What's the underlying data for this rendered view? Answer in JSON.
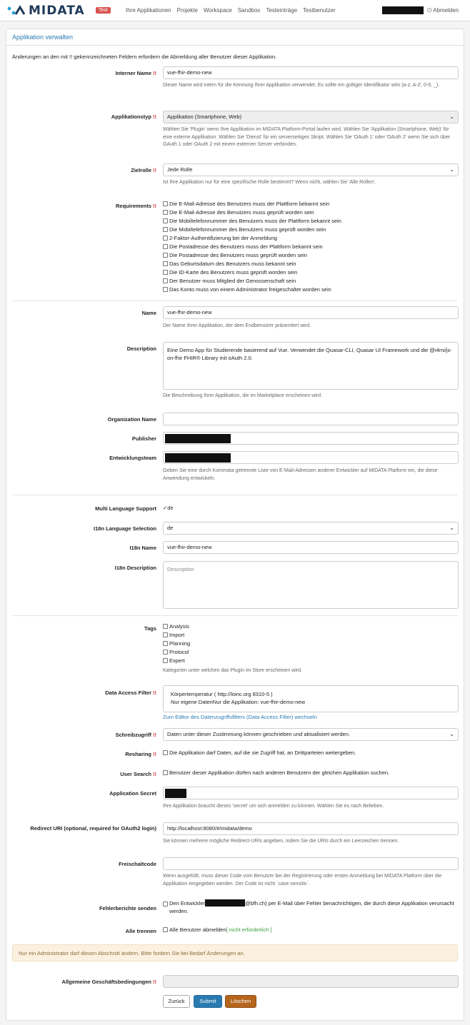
{
  "brand": {
    "logo_text": "MIDATA",
    "badge": "Test",
    "accent": "#2a7ab0"
  },
  "nav": {
    "links": [
      "Ihre Applikationen",
      "Projekte",
      "Workspace",
      "Sandbox",
      "Testeinträge",
      "Testbenutzer"
    ],
    "logout": "Abmelden"
  },
  "panel": {
    "title": "Applikation verwalten",
    "note": "Änderungen an den mit !! gekennzeichneten Feldern erfordern die Abmeldung aller Benutzer dieser Applikation."
  },
  "req_mark": "!!",
  "internal_name": {
    "label": "Interner Name",
    "value": "vue-fhir-demo-new",
    "help": "Dieser Name wird intern für die Kennung Ihrer Applikation verwendet. Es sollte ein gültiger Identifikator sein (a-z, A-Z, 0-9, _)."
  },
  "app_type": {
    "label": "Applikationstyp",
    "value": "Applikation (Smartphone, Web)",
    "help": "Wählen Sie 'Plugin' wenn Ihre Applikation im MIDATA Platform-Portal laufen wird. Wählen Sie 'Applikation (Smartphone, Web)' für eine externe Applikation. Wählen Sie 'Dienst' für ein serverseitiges Skript. Wählen Sie 'OAuth 1' oder 'OAuth 2' wenn Sie sich über OAuth 1 oder OAuth 2 mit einem externen Server verbinden."
  },
  "target_role": {
    "label": "Zielrolle",
    "value": "Jede Rolle",
    "help": "Ist Ihre Applikation nur für eine spezifische Rolle bestimmt? Wenn nicht, wählen Sie 'Alle Rollen'."
  },
  "requirements": {
    "label": "Requirements",
    "items": [
      "Die E-Mail-Adresse des Benutzers muss der Plattform bekannt sein",
      "Die E-Mail-Adresse des Benutzers muss geprüft worden sein",
      "Die Mobiltelefonnummer des Benutzers muss der Plattform bekannt sein",
      "Die Mobiltelefonnummer des Benutzers muss geprüft worden sein",
      "2-Faktor-Authentifizierung bei der Anmeldung",
      "Die Postadresse des Benutzers muss der Plattform bekannt sein",
      "Die Postadresse des Benutzers muss geprüft worden sein",
      "Das Geburtsdatum des Benutzers muss bekannt sein",
      "Die ID-Karte des Benutzers muss geprüft worden sein",
      "Der Benutzer muss Mitglied der Genossenschaft sein",
      "Das Konto muss von einem Administrator freigeschaltet worden sein"
    ]
  },
  "name": {
    "label": "Name",
    "value": "vue-fhir-demo-new",
    "help": "Der Name Ihrer Applikation, der dem Endbenutzer präsentiert wird."
  },
  "description": {
    "label": "Description",
    "value": "Eine Demo App für Studierende basierend auf Vue. Verwendet die Quasar-CLI, Quasar UI Framework und die @i4mi/js-on-fhir FHIR® Library mit oAuth 2.0.",
    "help": "Die Beschreibung Ihrer Applikation, die im Marketplace erscheinen wird."
  },
  "organization": {
    "label": "Organization Name",
    "value": ""
  },
  "publisher": {
    "label": "Publisher"
  },
  "dev_team": {
    "label": "Entwicklungsteam",
    "help": "Geben Sie eine durch Kommata getrennte Liste von E-Mail-Adressen anderer Entwickler auf MIDATA Platform ein, die diese Anwendung entwickeln."
  },
  "multi_language": {
    "label": "Multi Language Support",
    "value": "de"
  },
  "i18n_selection": {
    "label": "I18n Language Selection",
    "value": "de"
  },
  "i18n_name": {
    "label": "I18n Name",
    "value": "vue-fhir-demo-new"
  },
  "i18n_description": {
    "label": "I18n Description",
    "placeholder": "Description"
  },
  "tags": {
    "label": "Tags",
    "items": [
      "Analysis",
      "Import",
      "Planning",
      "Protocol",
      "Expert"
    ],
    "help": "Kategorien unter welchen das Plugin im Store erscheinen wird."
  },
  "data_access_filter": {
    "label": "Data Access Filter",
    "line1": "Körpertemperatur ( http://loinc.org 8310-5 )",
    "line2": "Nur eigene DatenNur die Applikation: vue-fhir-demo-new",
    "link": "Zum Editor des Datenzugriffsfilters (Data Access Filter) wechseln"
  },
  "write_access": {
    "label": "Schreibzugriff",
    "value": "Daten unter dieser Zustimmung können geschrieben und aktualisiert werden."
  },
  "resharing": {
    "label": "Resharing",
    "text": "Die Applikation darf Daten, auf die sie Zugriff hat, an Drittparteien weitergeben."
  },
  "user_search": {
    "label": "User Search",
    "text": "Benutzer dieser Applikation dürfen nach anderen Benutzern der gleichen Applikation suchen."
  },
  "app_secret": {
    "label": "Application Secret",
    "help": "Ihre Applikation braucht dieses 'secret' um sich anmelden zu können. Wählen Sie es nach Belieben."
  },
  "redirect_uri": {
    "label": "Redirect URI (optional, required for OAuth2 login)",
    "value": "http://localhost:8080/#/midata/demo",
    "help": "Sie können mehrere mögliche Redirect-URIs angeben, indem Sie die URIs durch ein Leerzeichen trennen."
  },
  "unlock_code": {
    "label": "Freischaltcode",
    "help": "Wenn ausgefüllt, muss dieser Code vom Benutzer bei der Registrierung oder ersten Anmeldung bei MIDATA Platform über die Applikation eingegeben werden. Der Code ist nicht `case sensitiv`."
  },
  "error_reports": {
    "label": "Fehlerberichte senden",
    "prefix": "Den Entwickler",
    "suffix": "@bfh.ch) per E-Mail über Fehler benachrichtigen, die durch diese Applikation verursacht werden."
  },
  "disconnect_all": {
    "label": "Alle trennen",
    "text": "Alle Benutzer abmelden",
    "note": "[ nicht erforderlich ]"
  },
  "admin_alert": "Nur ein Administrator darf diesen Abschnitt ändern. Bitte fordern Sie bei Bedarf Änderungen an.",
  "terms": {
    "label": "Allgemeine Geschäftsbedingungen"
  },
  "buttons": {
    "back": "Zurück",
    "submit": "Submit",
    "delete": "Löschen"
  }
}
